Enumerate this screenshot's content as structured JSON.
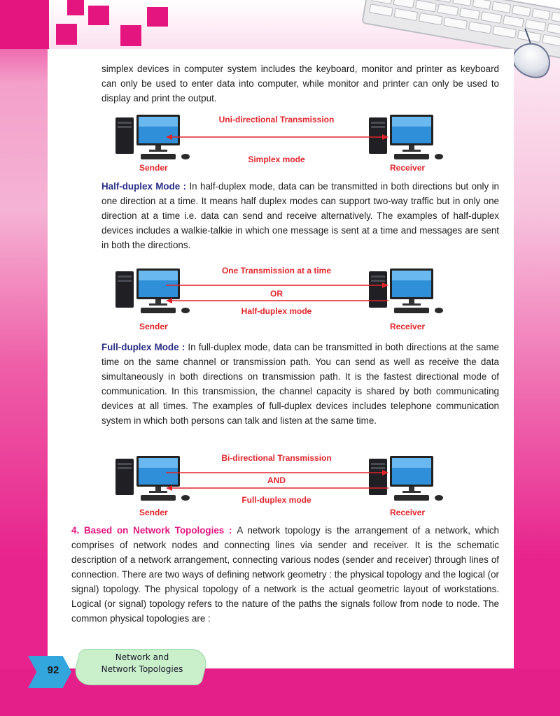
{
  "paragraphs": {
    "p1": "simplex devices in computer system includes the keyboard, monitor and printer as keyboard can only be used to enter data into computer, while monitor and printer can only be used to display and print the output.",
    "p2_term": "Half-duplex Mode :",
    "p2_body": " In half-duplex mode, data can be transmitted in both directions but only in one direction at a time. It means half duplex modes can support two-way traffic but in only one direction at a time i.e. data can send and receive alternatively. The examples of half-duplex devices includes a walkie-talkie in which one message is sent at a time and messages are sent in both the directions.",
    "p3_term": "Full-duplex Mode :",
    "p3_body": " In full-duplex mode, data can be transmitted in both directions at the same time on the same channel or transmission path. You can send as well as receive the data simultaneously in both directions on transmission path. It is the fastest directional mode of communication. In this transmission, the channel capacity is shared by both communicating devices at all times. The examples of full-duplex devices includes telephone communication system in which both persons can talk and listen at the same time.",
    "p4_head": "4.  Based on Network Topologies : ",
    "p4_body": "A network topology is the arrangement of a network, which comprises of network nodes and connecting lines via sender and receiver. It is the schematic description of a network arrangement, connecting various nodes (sender and receiver) through lines of connection. There are two ways of defining network geometry : the physical topology and the logical (or signal) topology. The physical topology of a network is the actual geometric layout of workstations. Logical (or signal) topology refers to the nature of the paths the signals follow from node to node. The common physical topologies are :"
  },
  "diagrams": {
    "simplex": {
      "top_label": "Uni-directional Transmission",
      "bottom_label": "Simplex mode",
      "sender": "Sender",
      "receiver": "Receiver"
    },
    "half_duplex": {
      "top_label": "One Transmission at a time",
      "middle_label": "OR",
      "bottom_label": "Half-duplex mode",
      "sender": "Sender",
      "receiver": "Receiver"
    },
    "full_duplex": {
      "top_label": "Bi-directional Transmission",
      "middle_label": "AND",
      "bottom_label": "Full-duplex mode",
      "sender": "Sender",
      "receiver": "Receiver"
    }
  },
  "footer": {
    "page_number": "92",
    "chapter_line1": "Network and",
    "chapter_line2": "Network Topologies"
  },
  "colors": {
    "accent_pink": "#e5157f",
    "term_blue": "#2a2e86",
    "diagram_red": "#e1242b",
    "page_tab_blue": "#32a6dd",
    "chapter_tab_green": "#c9efcb"
  },
  "icons": [
    "desktop-computer-icon",
    "keyboard-icon",
    "mouse-icon"
  ]
}
